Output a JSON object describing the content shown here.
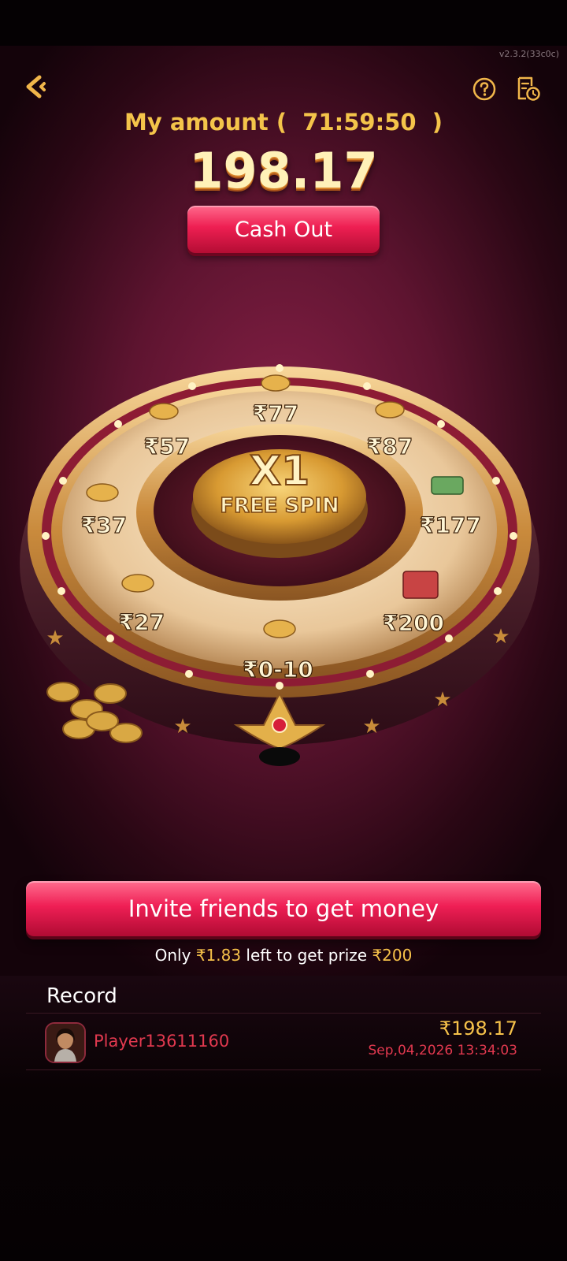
{
  "header": {
    "version": "v2.3.2(33c0c)",
    "back_icon": "back-arrow-icon",
    "help_icon": "help-icon",
    "history_icon": "history-icon"
  },
  "amount": {
    "label": "My amount (  71:59:50  )",
    "value": "198.17",
    "cash_out_label": "Cash Out"
  },
  "wheel": {
    "center_top": "X1",
    "center_bottom": "FREE SPIN",
    "prizes": [
      "₹77",
      "₹87",
      "₹177",
      "₹200",
      "₹0-10",
      "₹27",
      "₹37",
      "₹57"
    ]
  },
  "invite": {
    "button_label": "Invite friends to get money",
    "progress_prefix": "Only ",
    "remaining": "₹1.83",
    "progress_middle": " left to get prize ",
    "target": "₹200"
  },
  "record": {
    "title": "Record",
    "rows": [
      {
        "player": "Player13611160",
        "amount": "₹198.17",
        "time": "Sep,04,2026 13:34:03"
      }
    ]
  },
  "colors": {
    "accent_red": "#ee1f52",
    "gold": "#f4c44a",
    "background": "#5e1430"
  }
}
